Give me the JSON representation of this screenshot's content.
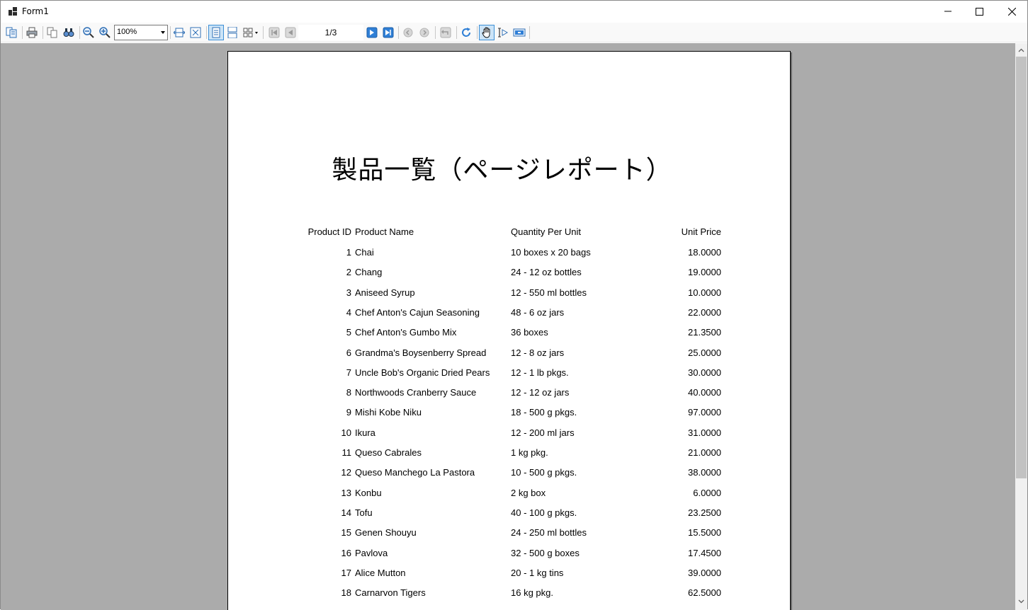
{
  "window": {
    "title": "Form1"
  },
  "toolbar": {
    "zoom_value": "100%",
    "page_indicator": "1/3"
  },
  "report": {
    "title": "製品一覧（ページレポート）",
    "columns": {
      "id": "Product ID",
      "name": "Product Name",
      "qty": "Quantity Per Unit",
      "price": "Unit Price"
    },
    "rows": [
      {
        "id": "1",
        "name": "Chai",
        "qty": "10 boxes x 20 bags",
        "price": "18.0000"
      },
      {
        "id": "2",
        "name": "Chang",
        "qty": "24 - 12 oz bottles",
        "price": "19.0000"
      },
      {
        "id": "3",
        "name": "Aniseed Syrup",
        "qty": "12 - 550 ml bottles",
        "price": "10.0000"
      },
      {
        "id": "4",
        "name": "Chef Anton's Cajun Seasoning",
        "qty": "48 - 6 oz jars",
        "price": "22.0000"
      },
      {
        "id": "5",
        "name": "Chef Anton's Gumbo Mix",
        "qty": "36 boxes",
        "price": "21.3500"
      },
      {
        "id": "6",
        "name": "Grandma's Boysenberry Spread",
        "qty": "12 - 8 oz jars",
        "price": "25.0000"
      },
      {
        "id": "7",
        "name": "Uncle Bob's Organic Dried Pears",
        "qty": "12 - 1 lb pkgs.",
        "price": "30.0000"
      },
      {
        "id": "8",
        "name": "Northwoods Cranberry Sauce",
        "qty": "12 - 12 oz jars",
        "price": "40.0000"
      },
      {
        "id": "9",
        "name": "Mishi Kobe Niku",
        "qty": "18 - 500 g pkgs.",
        "price": "97.0000"
      },
      {
        "id": "10",
        "name": "Ikura",
        "qty": "12 - 200 ml jars",
        "price": "31.0000"
      },
      {
        "id": "11",
        "name": "Queso Cabrales",
        "qty": "1 kg pkg.",
        "price": "21.0000"
      },
      {
        "id": "12",
        "name": "Queso Manchego La Pastora",
        "qty": "10 - 500 g pkgs.",
        "price": "38.0000"
      },
      {
        "id": "13",
        "name": "Konbu",
        "qty": "2 kg box",
        "price": "6.0000"
      },
      {
        "id": "14",
        "name": "Tofu",
        "qty": "40 - 100 g pkgs.",
        "price": "23.2500"
      },
      {
        "id": "15",
        "name": "Genen Shouyu",
        "qty": "24 - 250 ml bottles",
        "price": "15.5000"
      },
      {
        "id": "16",
        "name": "Pavlova",
        "qty": "32 - 500 g boxes",
        "price": "17.4500"
      },
      {
        "id": "17",
        "name": "Alice Mutton",
        "qty": "20 - 1 kg tins",
        "price": "39.0000"
      },
      {
        "id": "18",
        "name": "Carnarvon Tigers",
        "qty": "16 kg pkg.",
        "price": "62.5000"
      }
    ]
  }
}
